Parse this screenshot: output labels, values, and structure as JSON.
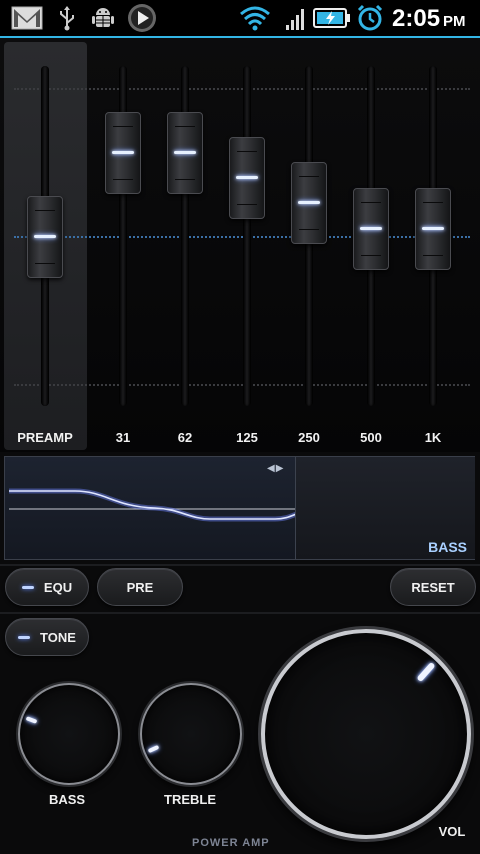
{
  "status_bar": {
    "time": "2:05",
    "ampm": "PM",
    "icons": [
      "gmail-icon",
      "usb-icon",
      "android-debug-icon",
      "play-icon",
      "wifi-icon",
      "signal-icon",
      "battery-charging-icon",
      "alarm-icon"
    ]
  },
  "equalizer": {
    "preamp": {
      "label": "PREAMP",
      "level": 0.5
    },
    "bands": [
      {
        "label": "31",
        "level": 0.8
      },
      {
        "label": "62",
        "level": 0.8
      },
      {
        "label": "125",
        "level": 0.71
      },
      {
        "label": "250",
        "level": 0.62
      },
      {
        "label": "500",
        "level": 0.53
      },
      {
        "label": "1K",
        "level": 0.53
      }
    ]
  },
  "graph": {
    "label": "BASS",
    "arrows": "◀▶"
  },
  "buttons": {
    "equ": "EQU",
    "pre": "PRE",
    "reset": "RESET",
    "tone": "TONE"
  },
  "knobs": {
    "bass": "BASS",
    "treble": "TREBLE",
    "vol": "VOL"
  },
  "brand": "POWER AMP",
  "colors": {
    "accent": "#33b5e5",
    "led": "#5c86ff",
    "graph_line": "#b8c6ff",
    "label_blue": "#a9d0ff"
  }
}
